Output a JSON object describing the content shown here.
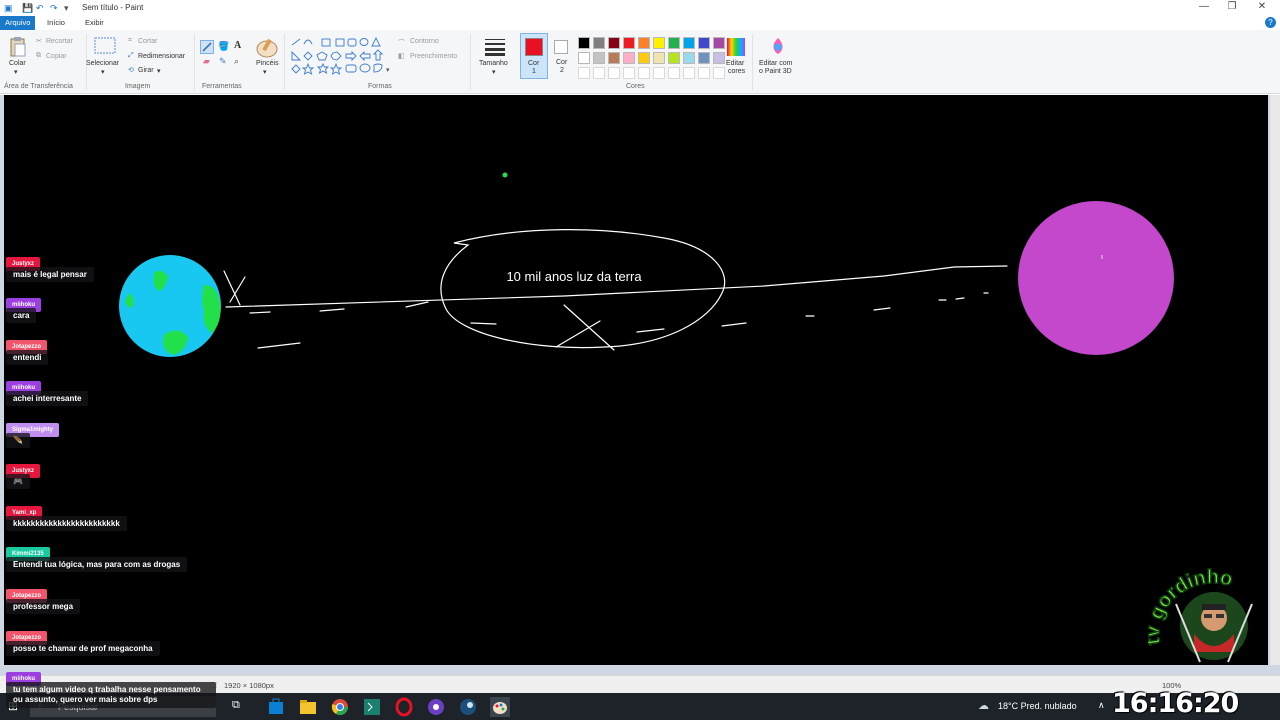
{
  "window": {
    "title": "Sem título - Paint",
    "controls": {
      "minimize": "—",
      "maximize": "❐",
      "close": "✕"
    }
  },
  "tabs": [
    {
      "label": "Arquivo",
      "active": true
    },
    {
      "label": "Início",
      "active": false
    },
    {
      "label": "Exibir",
      "active": false
    }
  ],
  "ribbon": {
    "clipboard": {
      "paste": "Colar",
      "cut": "Recortar",
      "copy": "Copiar",
      "group": "Área de Transferência"
    },
    "image": {
      "select": "Selecionar",
      "crop": "Cortar",
      "resize": "Redimensionar",
      "rotate": "Girar",
      "group": "Imagem"
    },
    "tools": {
      "brushes": "Pincéis",
      "group": "Ferramentas"
    },
    "shapes": {
      "outline": "Contorno",
      "fill": "Preenchimento",
      "group": "Formas"
    },
    "size": {
      "label": "Tamanho"
    },
    "color1": {
      "label": "Cor",
      "num": "1",
      "value": "#e81123"
    },
    "color2": {
      "label": "Cor",
      "num": "2",
      "value": "#ffffff"
    },
    "colors": {
      "group": "Cores",
      "row1": [
        "#000000",
        "#7f7f7f",
        "#880015",
        "#ed1c24",
        "#ff7f27",
        "#fff200",
        "#22b14c",
        "#00a2e8",
        "#3f48cc",
        "#a349a4"
      ],
      "row2": [
        "#ffffff",
        "#c3c3c3",
        "#b97a57",
        "#ffaec9",
        "#ffc90e",
        "#efe4b0",
        "#b5e61d",
        "#99d9ea",
        "#7092be",
        "#c8bfe7"
      ]
    },
    "edit_colors": {
      "line1": "Editar",
      "line2": "cores"
    },
    "paint3d": {
      "line1": "Editar com",
      "line2": "o Paint 3D"
    }
  },
  "canvas": {
    "annotation_text": "10 mil anos luz da terra",
    "earth_colors": {
      "ocean": "#18c8f0",
      "land": "#22e04a"
    },
    "planet_color": "#c448cc"
  },
  "status": {
    "dimensions": "1920 × 1080px",
    "zoom": "100%"
  },
  "chat": [
    {
      "user": "Justyxz",
      "user_color": "#e5173f",
      "message": "mais é legal pensar"
    },
    {
      "user": "miihoku",
      "user_color": "#9b3fe0",
      "message": "cara"
    },
    {
      "user": "Jotapezzo",
      "user_color": "#f0556c",
      "message": "entendi"
    },
    {
      "user": "miihoku",
      "user_color": "#9b3fe0",
      "message": "achei interresante"
    },
    {
      "user": "Sigma1mighty",
      "user_color": "#c08ef0",
      "message": "🪶"
    },
    {
      "user": "Justyxz",
      "user_color": "#e5173f",
      "message": "🎮"
    },
    {
      "user": "Yami_xp",
      "user_color": "#e5173f",
      "message": "kkkkkkkkkkkkkkkkkkkkkkkk"
    },
    {
      "user": "Kimmi2135",
      "user_color": "#19c9a0",
      "message": "Entendi tua lógica, mas para com as drogas"
    },
    {
      "user": "Jotapezzo",
      "user_color": "#f0556c",
      "message": "professor mega"
    },
    {
      "user": "Jotapezzo",
      "user_color": "#f0556c",
      "message": "posso te chamar de prof megaconha"
    },
    {
      "user": "miihoku",
      "user_color": "#9b3fe0",
      "message": "tu tem algum video q trabalha nesse pensamento ou assunto, quero ver mais sobre dps"
    }
  ],
  "taskbar": {
    "search_placeholder": "Pesquisar",
    "weather": "18°C  Pred. nublado"
  },
  "overlay": {
    "clock": "16:16:20",
    "logo_text": "tv gordinho"
  }
}
